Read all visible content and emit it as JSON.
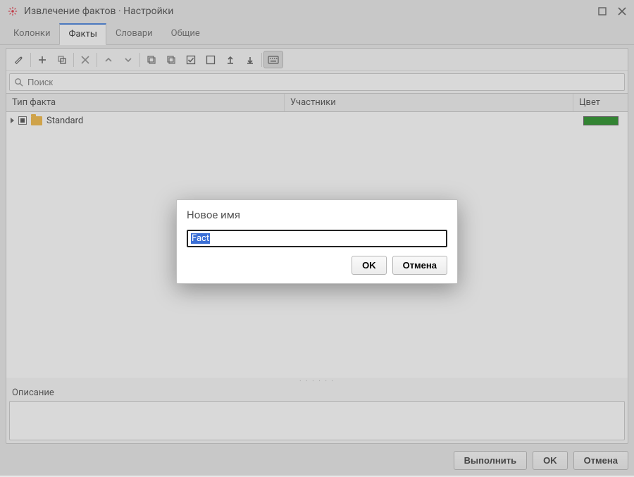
{
  "window": {
    "title": "Извлечение фактов · Настройки"
  },
  "tabs": [
    {
      "label": "Колонки",
      "active": false
    },
    {
      "label": "Факты",
      "active": true
    },
    {
      "label": "Словари",
      "active": false
    },
    {
      "label": "Общие",
      "active": false
    }
  ],
  "search": {
    "placeholder": "Поиск"
  },
  "table": {
    "columns": [
      "Тип факта",
      "Участники",
      "Цвет"
    ],
    "rows": [
      {
        "name": "Standard",
        "color": "#1a8a1a"
      }
    ]
  },
  "description": {
    "label": "Описание",
    "value": ""
  },
  "buttons": {
    "execute": "Выполнить",
    "ok": "OK",
    "cancel": "Отмена"
  },
  "dialog": {
    "title": "Новое имя",
    "value": "Fact",
    "ok": "OK",
    "cancel": "Отмена"
  }
}
